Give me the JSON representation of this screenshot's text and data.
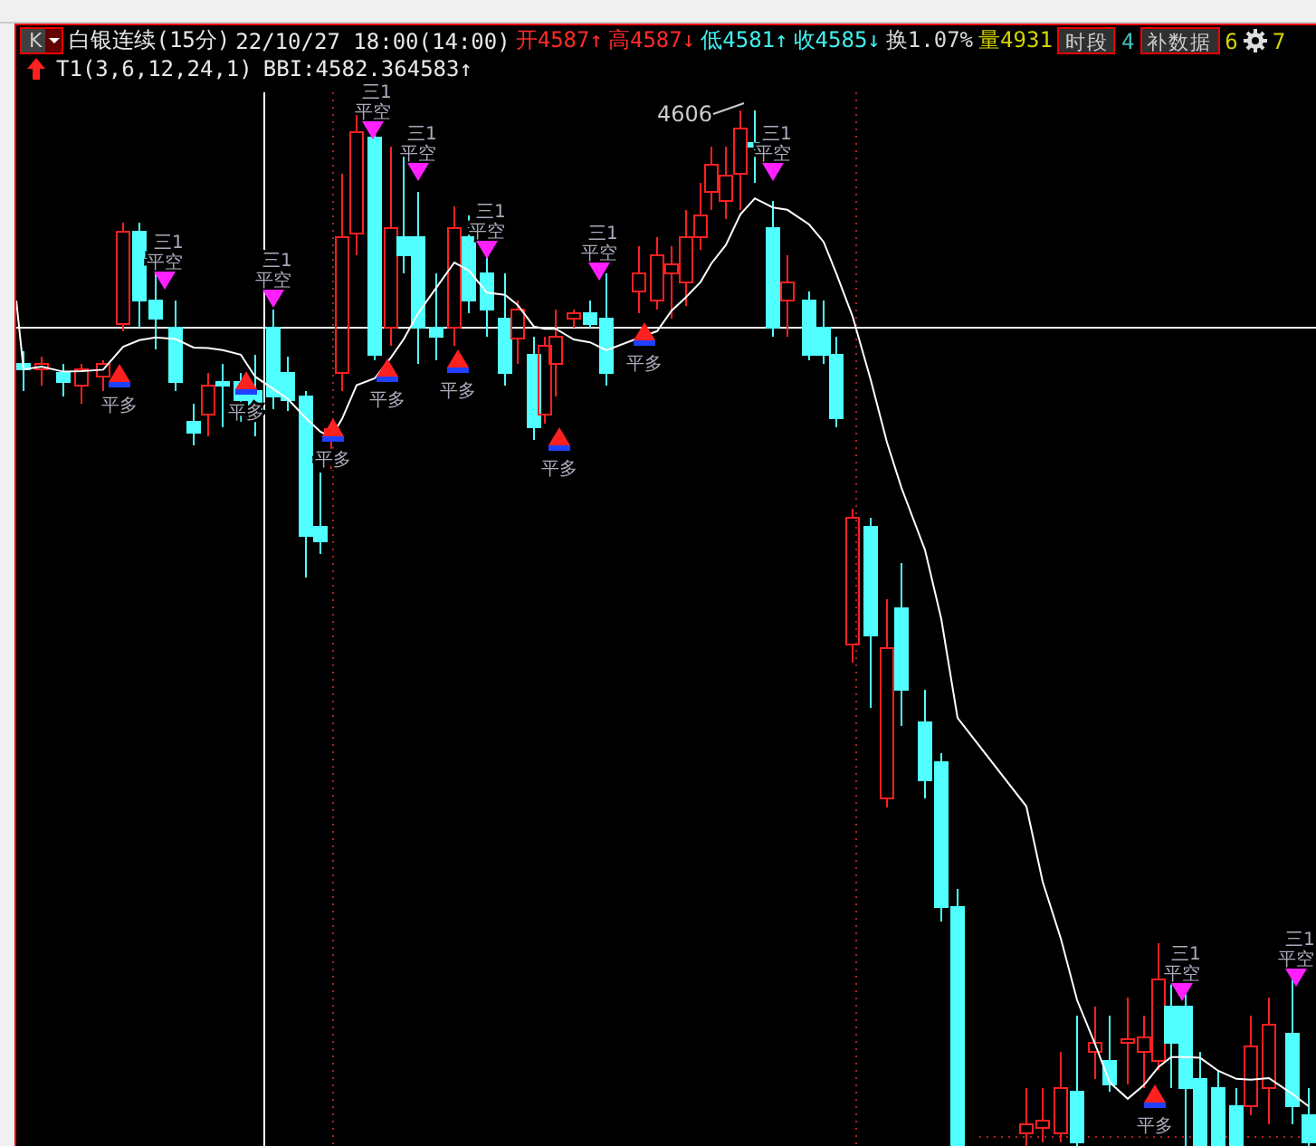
{
  "header": {
    "period_button": "K",
    "instrument": "白银连续(15分)",
    "datetime": "22/10/27 18:00(14:00)",
    "quotes": [
      {
        "label": "开",
        "value": "4587",
        "arrow": "↑",
        "color": "#ff2a2a"
      },
      {
        "label": "高",
        "value": "4587",
        "arrow": "↓",
        "color": "#ff2a2a"
      },
      {
        "label": "低",
        "value": "4581",
        "arrow": "↑",
        "color": "#40f0f0"
      },
      {
        "label": "收",
        "value": "4585",
        "arrow": "↓",
        "color": "#40f0f0"
      },
      {
        "label": "换",
        "value": "1.07%",
        "color": "#d8d8d8"
      },
      {
        "label": "量",
        "value": "4931",
        "color": "#d4d400"
      }
    ],
    "tail": [
      {
        "kind": "button",
        "text": "时段"
      },
      {
        "kind": "text",
        "text": "4",
        "color": "#40c0c0"
      },
      {
        "kind": "button",
        "text": "补数据"
      },
      {
        "kind": "text",
        "text": "6",
        "color": "#d4d400"
      },
      {
        "kind": "gear"
      },
      {
        "kind": "text",
        "text": "7",
        "color": "#d4d400"
      }
    ]
  },
  "indicator": {
    "name": "T1(3,6,12,24,1)",
    "value": "BBI:4582.364583",
    "arrow": "↑"
  },
  "chart": {
    "peak_label": "4606",
    "signals": [
      {
        "kind": "buy",
        "label": "平多"
      },
      {
        "kind": "sell",
        "count": "三1",
        "label": "平空"
      },
      {
        "kind": "buy",
        "label": "平多"
      },
      {
        "kind": "sell",
        "count": "三1",
        "label": "平空"
      },
      {
        "kind": "buy",
        "label": "平多"
      },
      {
        "kind": "sell",
        "count": "三1",
        "label": "平空"
      },
      {
        "kind": "buy",
        "label": "平多"
      },
      {
        "kind": "sell",
        "count": "三1",
        "label": "平空"
      },
      {
        "kind": "buy",
        "label": "平多"
      },
      {
        "kind": "sell",
        "count": "三1",
        "label": "平空"
      },
      {
        "kind": "buy",
        "label": "平多"
      },
      {
        "kind": "sell",
        "count": "三1",
        "label": "平空"
      },
      {
        "kind": "buy",
        "label": "平多"
      },
      {
        "kind": "sell",
        "count": "三1",
        "label": "平空"
      },
      {
        "kind": "buy",
        "label": "平多"
      },
      {
        "kind": "sell",
        "count": "三1",
        "label": "平空"
      },
      {
        "kind": "sell",
        "count": "三1",
        "label": "平空"
      }
    ]
  }
}
